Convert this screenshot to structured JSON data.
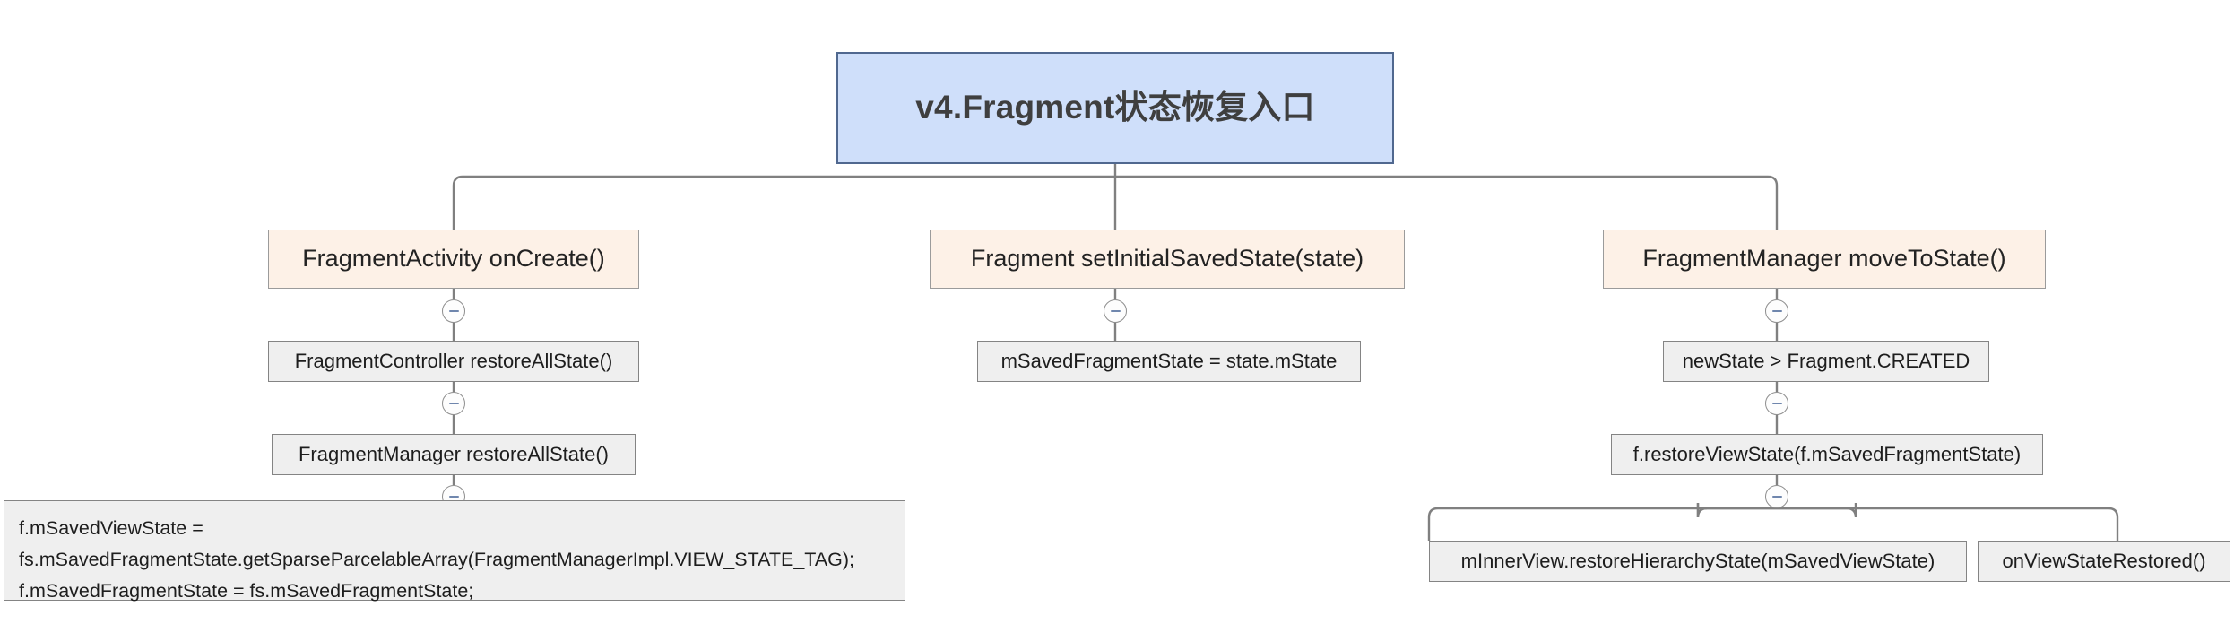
{
  "diagram": {
    "title": "v4.Fragment状态恢复入口",
    "type": "flowchart-tree",
    "orientation": "top-down",
    "colors": {
      "root_fill": "#cfdffa",
      "root_border": "#50688f",
      "branch_fill": "#fdf1e7",
      "branch_border": "#9b9b9b",
      "step_fill": "#efefef",
      "step_border": "#848484",
      "edge": "#808080",
      "toggle_minus": "#6f86ad",
      "background": "#ffffff"
    },
    "root": {
      "label": "v4.Fragment状态恢复入口"
    },
    "branches": [
      {
        "id": "branch-fragmentactivity-oncreate",
        "label": "FragmentActivity onCreate()",
        "toggle": "collapse-minus",
        "children": [
          {
            "id": "step-fragmentcontroller-restoreallstate",
            "label": "FragmentController restoreAllState()",
            "toggle": "collapse-minus"
          },
          {
            "id": "step-fragmentmanager-restoreallstate",
            "label": "FragmentManager restoreAllState()",
            "toggle": "collapse-minus"
          }
        ],
        "code_block": {
          "id": "code-saved-view-state",
          "lines": [
            "f.mSavedViewState =",
            "fs.mSavedFragmentState.getSparseParcelableArray(FragmentManagerImpl.VIEW_STATE_TAG);",
            "f.mSavedFragmentState = fs.mSavedFragmentState;"
          ]
        }
      },
      {
        "id": "branch-fragment-setinitialsavedstate",
        "label": "Fragment setInitialSavedState(state)",
        "toggle": "collapse-minus",
        "children": [
          {
            "id": "step-msavedfragmentstate-assign",
            "label": "mSavedFragmentState = state.mState",
            "toggle": "none"
          }
        ]
      },
      {
        "id": "branch-fragmentmanager-movetostate",
        "label": "FragmentManager moveToState()",
        "toggle": "collapse-minus",
        "children": [
          {
            "id": "step-newstate-gt-created",
            "label": "newState > Fragment.CREATED",
            "toggle": "collapse-minus"
          },
          {
            "id": "step-restoreviewstate",
            "label": "f.restoreViewState(f.mSavedFragmentState)",
            "toggle": "collapse-minus"
          },
          {
            "id": "step-minnerview-restorehierarchystate",
            "label": "mInnerView.restoreHierarchyState(mSavedViewState)",
            "toggle": "none"
          },
          {
            "id": "step-onviewstaterestored",
            "label": "onViewStateRestored()",
            "toggle": "none"
          }
        ]
      }
    ]
  }
}
